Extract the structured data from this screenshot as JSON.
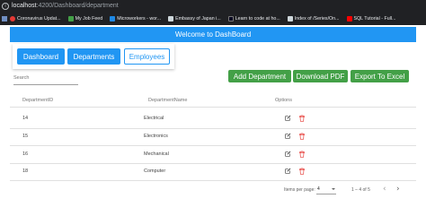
{
  "browser": {
    "url_host": "localhost",
    "url_path": ":4200/Dashboard/department",
    "bookmarks": [
      {
        "label": "Coronavirus Updat...",
        "icon": "coronavirus-favicon",
        "color": "#e53935"
      },
      {
        "label": "My Job Feed",
        "icon": "job-feed-favicon",
        "color": "#43a047"
      },
      {
        "label": "Microworkers - wor...",
        "icon": "microworkers-favicon",
        "color": "#1e88e5"
      },
      {
        "label": "Embassy of Japan i...",
        "icon": "embassy-favicon",
        "color": "#cfd8dc"
      },
      {
        "label": "Learn to code at ho...",
        "icon": "learn-code-favicon",
        "color": "#0a0a23"
      },
      {
        "label": "Index of /Series/On...",
        "icon": "folder-favicon",
        "color": "#cfd8dc"
      },
      {
        "label": "SQL Tutorial - Full...",
        "icon": "youtube-favicon",
        "color": "#ff0000"
      }
    ]
  },
  "header": {
    "title": "Welcome to DashBoard"
  },
  "nav": {
    "dashboard": "Dashboard",
    "departments": "Departments",
    "employees": "Employees"
  },
  "search": {
    "label": "Search"
  },
  "actions": {
    "add": "Add Department",
    "pdf": "Download PDF",
    "excel": "Export To Excel"
  },
  "table": {
    "columns": [
      "DepartmentID",
      "DepartmentName",
      "Options"
    ],
    "rows": [
      {
        "id": "14",
        "name": "Electrical"
      },
      {
        "id": "15",
        "name": "Electronics"
      },
      {
        "id": "16",
        "name": "Mechanical"
      },
      {
        "id": "18",
        "name": "Computer"
      }
    ]
  },
  "paginator": {
    "label": "Items per page:",
    "page_size": "4",
    "range": "1 – 4 of 5"
  },
  "colors": {
    "primary": "#2196f3",
    "success": "#43a047",
    "delete": "#e53935"
  }
}
